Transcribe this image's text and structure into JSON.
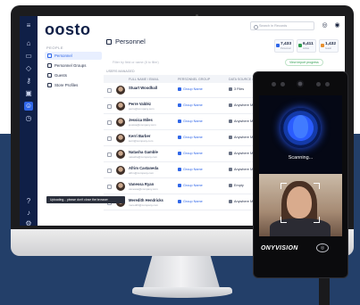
{
  "app": {
    "logo": "oosto",
    "page_title": "Personnel",
    "search_placeholder": "Search in Records"
  },
  "sidebar": {
    "section_title": "PEOPLE",
    "items": [
      {
        "label": "Personnel",
        "active": true
      },
      {
        "label": "Personnel Groups",
        "active": false
      },
      {
        "label": "Guests",
        "active": false
      },
      {
        "label": "Store Profiles",
        "active": false
      }
    ]
  },
  "stats": [
    {
      "value": "7,433",
      "label": "Personnel",
      "color": "#2f66e8"
    },
    {
      "value": "6,411",
      "label": "Active",
      "color": "#2f9d4f"
    },
    {
      "value": "1,432",
      "label": "Guest",
      "color": "#e8912f"
    }
  ],
  "filter": {
    "placeholder": "Filter by field or name (8 to filter)",
    "progress_label": "View import progress"
  },
  "table": {
    "section_label": "USERS MANAGED",
    "headers": [
      "FULL NAME / EMAIL",
      "PERSONNEL GROUP",
      "DATA SOURCE / UPLOAD"
    ],
    "rows": [
      {
        "name": "Stuart Woodhall",
        "email": "",
        "group": "Group Name",
        "source": "3 Files"
      },
      {
        "name": "Perre Valdéz",
        "email": "perre@company.com",
        "group": "Group Name",
        "source": "Anywhere Mas..."
      },
      {
        "name": "Jessica Miles",
        "email": "jessica@company.com",
        "group": "Group Name",
        "source": "Anywhere Mas..."
      },
      {
        "name": "Kerri Barber",
        "email": "kerri@company.com",
        "group": "Group Name",
        "source": "Anywhere Mas..."
      },
      {
        "name": "Natasha Gamble",
        "email": "natasha@company.com",
        "group": "Group Name",
        "source": "Anywhere Mas..."
      },
      {
        "name": "Afrim Castaneda",
        "email": "afrim@company.com",
        "group": "Group Name",
        "source": "Anywhere Mas..."
      },
      {
        "name": "Vanessa Ryan",
        "email": "vanessa@company.com",
        "group": "Group Name",
        "source": "Empty"
      },
      {
        "name": "Meredith Hendricks",
        "email": "meredith@company.com",
        "group": "Group Name",
        "source": "Anywhere Mas..."
      }
    ]
  },
  "toast": {
    "text": "Uploading... please don't close the browser"
  },
  "terminal": {
    "status": "Scanning...",
    "brand": "ONYVISION"
  }
}
